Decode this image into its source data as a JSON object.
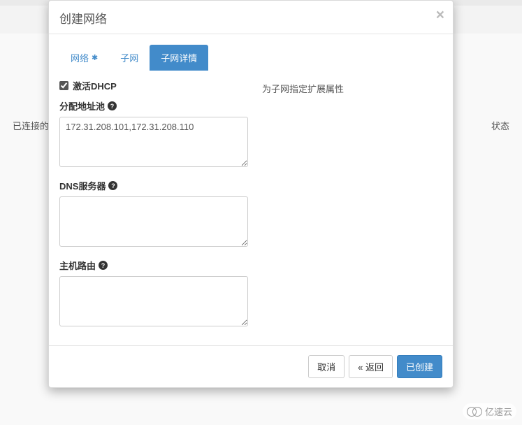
{
  "background": {
    "left_label": "已连接的",
    "right_label": "状态"
  },
  "modal": {
    "title": "创建网络",
    "tabs": [
      {
        "label": "网络",
        "required": true,
        "active": false
      },
      {
        "label": "子网",
        "required": false,
        "active": false
      },
      {
        "label": "子网详情",
        "required": false,
        "active": true
      }
    ],
    "help_text": "为子网指定扩展属性",
    "dhcp": {
      "label": "激活DHCP",
      "checked": true
    },
    "allocation_pool": {
      "label": "分配地址池",
      "value": "172.31.208.101,172.31.208.110"
    },
    "dns_servers": {
      "label": "DNS服务器",
      "value": ""
    },
    "host_routes": {
      "label": "主机路由",
      "value": ""
    },
    "footer": {
      "cancel": "取消",
      "back": "« 返回",
      "submit": "已创建"
    }
  },
  "watermark": "亿速云"
}
